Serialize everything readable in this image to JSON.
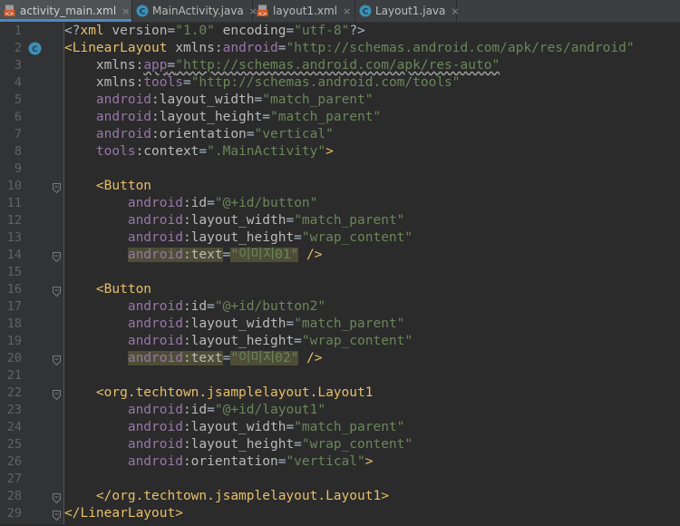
{
  "tabs": [
    {
      "label": "activity_main.xml",
      "icon": "xml-file-icon",
      "active": true
    },
    {
      "label": "MainActivity.java",
      "icon": "java-class-icon",
      "active": false
    },
    {
      "label": "layout1.xml",
      "icon": "xml-file-icon",
      "active": false
    },
    {
      "label": "Layout1.java",
      "icon": "java-class-icon",
      "active": false
    }
  ],
  "tab_close_glyph": "×",
  "colors": {
    "accent": "#4a88c7",
    "background": "#2b2b2b",
    "gutter": "#313335"
  },
  "lines": [
    {
      "n": "1",
      "tokens": [
        [
          "kr",
          "<?"
        ],
        [
          "tag",
          "xml "
        ],
        [
          "attr",
          "version"
        ],
        [
          "kr",
          "="
        ],
        [
          "str",
          "\"1.0\""
        ],
        [
          "kr",
          " "
        ],
        [
          "attr",
          "encoding"
        ],
        [
          "kr",
          "="
        ],
        [
          "str",
          "\"utf-8\""
        ],
        [
          "kr",
          "?>"
        ]
      ]
    },
    {
      "n": "2",
      "tokens": [
        [
          "tag",
          "<LinearLayout "
        ],
        [
          "attr",
          "xmlns:"
        ],
        [
          "ns",
          "android"
        ],
        [
          "kr",
          "="
        ],
        [
          "str",
          "\"http://schemas.android.com/apk/res/android\""
        ]
      ],
      "gicon": "c"
    },
    {
      "n": "3",
      "tokens": [
        [
          "attr",
          "    xmlns:"
        ],
        [
          "ns",
          "app"
        ],
        [
          "kr",
          "="
        ],
        [
          "str",
          "\"http://schemas.android.com/apk/res-auto\""
        ]
      ],
      "wavy": true
    },
    {
      "n": "4",
      "tokens": [
        [
          "attr",
          "    xmlns:"
        ],
        [
          "ns",
          "tools"
        ],
        [
          "kr",
          "="
        ],
        [
          "str",
          "\"http://schemas.android.com/tools\""
        ]
      ]
    },
    {
      "n": "5",
      "tokens": [
        [
          "ns",
          "    android"
        ],
        [
          "attr",
          ":layout_width"
        ],
        [
          "kr",
          "="
        ],
        [
          "str",
          "\"match_parent\""
        ]
      ]
    },
    {
      "n": "6",
      "tokens": [
        [
          "ns",
          "    android"
        ],
        [
          "attr",
          ":layout_height"
        ],
        [
          "kr",
          "="
        ],
        [
          "str",
          "\"match_parent\""
        ]
      ]
    },
    {
      "n": "7",
      "tokens": [
        [
          "ns",
          "    android"
        ],
        [
          "attr",
          ":orientation"
        ],
        [
          "kr",
          "="
        ],
        [
          "str",
          "\"vertical\""
        ]
      ]
    },
    {
      "n": "8",
      "tokens": [
        [
          "ns",
          "    tools"
        ],
        [
          "attr",
          ":context"
        ],
        [
          "kr",
          "="
        ],
        [
          "str",
          "\".MainActivity\""
        ],
        [
          "tag",
          ">"
        ]
      ]
    },
    {
      "n": "9",
      "tokens": []
    },
    {
      "n": "10",
      "tokens": [
        [
          "tag",
          "    <Button"
        ]
      ],
      "gicon": "fold"
    },
    {
      "n": "11",
      "tokens": [
        [
          "ns",
          "        android"
        ],
        [
          "attr",
          ":id"
        ],
        [
          "kr",
          "="
        ],
        [
          "str",
          "\"@+id/button\""
        ]
      ]
    },
    {
      "n": "12",
      "tokens": [
        [
          "ns",
          "        android"
        ],
        [
          "attr",
          ":layout_width"
        ],
        [
          "kr",
          "="
        ],
        [
          "str",
          "\"match_parent\""
        ]
      ]
    },
    {
      "n": "13",
      "tokens": [
        [
          "ns",
          "        android"
        ],
        [
          "attr",
          ":layout_height"
        ],
        [
          "kr",
          "="
        ],
        [
          "str",
          "\"wrap_content\""
        ]
      ]
    },
    {
      "n": "14",
      "tokens": [
        [
          "ns",
          "        android"
        ],
        [
          "attr",
          ":text"
        ],
        [
          "kr",
          "="
        ],
        [
          "str",
          "\"이미지01\""
        ],
        [
          "tag",
          " />"
        ]
      ],
      "hl": true,
      "gicon": "fold"
    },
    {
      "n": "15",
      "tokens": []
    },
    {
      "n": "16",
      "tokens": [
        [
          "tag",
          "    <Button"
        ]
      ],
      "gicon": "fold"
    },
    {
      "n": "17",
      "tokens": [
        [
          "ns",
          "        android"
        ],
        [
          "attr",
          ":id"
        ],
        [
          "kr",
          "="
        ],
        [
          "str",
          "\"@+id/button2\""
        ]
      ]
    },
    {
      "n": "18",
      "tokens": [
        [
          "ns",
          "        android"
        ],
        [
          "attr",
          ":layout_width"
        ],
        [
          "kr",
          "="
        ],
        [
          "str",
          "\"match_parent\""
        ]
      ]
    },
    {
      "n": "19",
      "tokens": [
        [
          "ns",
          "        android"
        ],
        [
          "attr",
          ":layout_height"
        ],
        [
          "kr",
          "="
        ],
        [
          "str",
          "\"wrap_content\""
        ]
      ]
    },
    {
      "n": "20",
      "tokens": [
        [
          "ns",
          "        android"
        ],
        [
          "attr",
          ":text"
        ],
        [
          "kr",
          "="
        ],
        [
          "str",
          "\"이미지02\""
        ],
        [
          "tag",
          " />"
        ]
      ],
      "hl": true,
      "gicon": "fold"
    },
    {
      "n": "21",
      "tokens": []
    },
    {
      "n": "22",
      "tokens": [
        [
          "tag",
          "    <org.techtown.jsamplelayout.Layout1"
        ]
      ],
      "gicon": "fold"
    },
    {
      "n": "23",
      "tokens": [
        [
          "ns",
          "        android"
        ],
        [
          "attr",
          ":id"
        ],
        [
          "kr",
          "="
        ],
        [
          "str",
          "\"@+id/layout1\""
        ]
      ]
    },
    {
      "n": "24",
      "tokens": [
        [
          "ns",
          "        android"
        ],
        [
          "attr",
          ":layout_width"
        ],
        [
          "kr",
          "="
        ],
        [
          "str",
          "\"match_parent\""
        ]
      ]
    },
    {
      "n": "25",
      "tokens": [
        [
          "ns",
          "        android"
        ],
        [
          "attr",
          ":layout_height"
        ],
        [
          "kr",
          "="
        ],
        [
          "str",
          "\"wrap_content\""
        ]
      ]
    },
    {
      "n": "26",
      "tokens": [
        [
          "ns",
          "        android"
        ],
        [
          "attr",
          ":orientation"
        ],
        [
          "kr",
          "="
        ],
        [
          "str",
          "\"vertical\""
        ],
        [
          "tag",
          ">"
        ]
      ]
    },
    {
      "n": "27",
      "tokens": []
    },
    {
      "n": "28",
      "tokens": [
        [
          "tag",
          "    </org.techtown.jsamplelayout.Layout1>"
        ]
      ],
      "gicon": "fold"
    },
    {
      "n": "29",
      "tokens": [
        [
          "tag",
          "</LinearLayout>"
        ]
      ],
      "gicon": "fold"
    }
  ]
}
